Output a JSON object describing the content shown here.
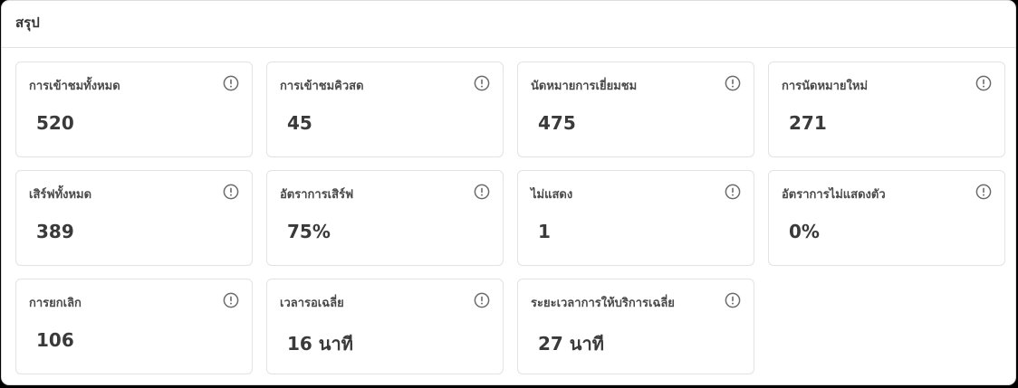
{
  "summary": {
    "title": "สรุป",
    "cards": [
      {
        "label": "การเข้าชมทั้งหมด",
        "value": "520",
        "icon": "info-icon"
      },
      {
        "label": "การเข้าชมคิวสด",
        "value": "45",
        "icon": "info-icon"
      },
      {
        "label": "นัดหมายการเยี่ยมชม",
        "value": "475",
        "icon": "info-icon"
      },
      {
        "label": "การนัดหมายใหม่",
        "value": "271",
        "icon": "info-icon"
      },
      {
        "label": "เสิร์ฟทั้งหมด",
        "value": "389",
        "icon": "info-icon"
      },
      {
        "label": "อัตราการเสิร์ฟ",
        "value": "75%",
        "icon": "info-icon"
      },
      {
        "label": "ไม่แสดง",
        "value": "1",
        "icon": "info-icon"
      },
      {
        "label": "อัตราการไม่แสดงตัว",
        "value": "0%",
        "icon": "info-icon"
      },
      {
        "label": "การยกเลิก",
        "value": "106",
        "icon": "info-icon"
      },
      {
        "label": "เวลารอเฉลี่ย",
        "value": "16 นาที",
        "icon": "info-icon"
      },
      {
        "label": "ระยะเวลาการให้บริการเฉลี่ย",
        "value": "27 นาที",
        "icon": "info-icon"
      }
    ]
  },
  "colors": {
    "text": "#3a3a3a",
    "border": "#e3e3e3",
    "icon": "#6b6b6b"
  }
}
